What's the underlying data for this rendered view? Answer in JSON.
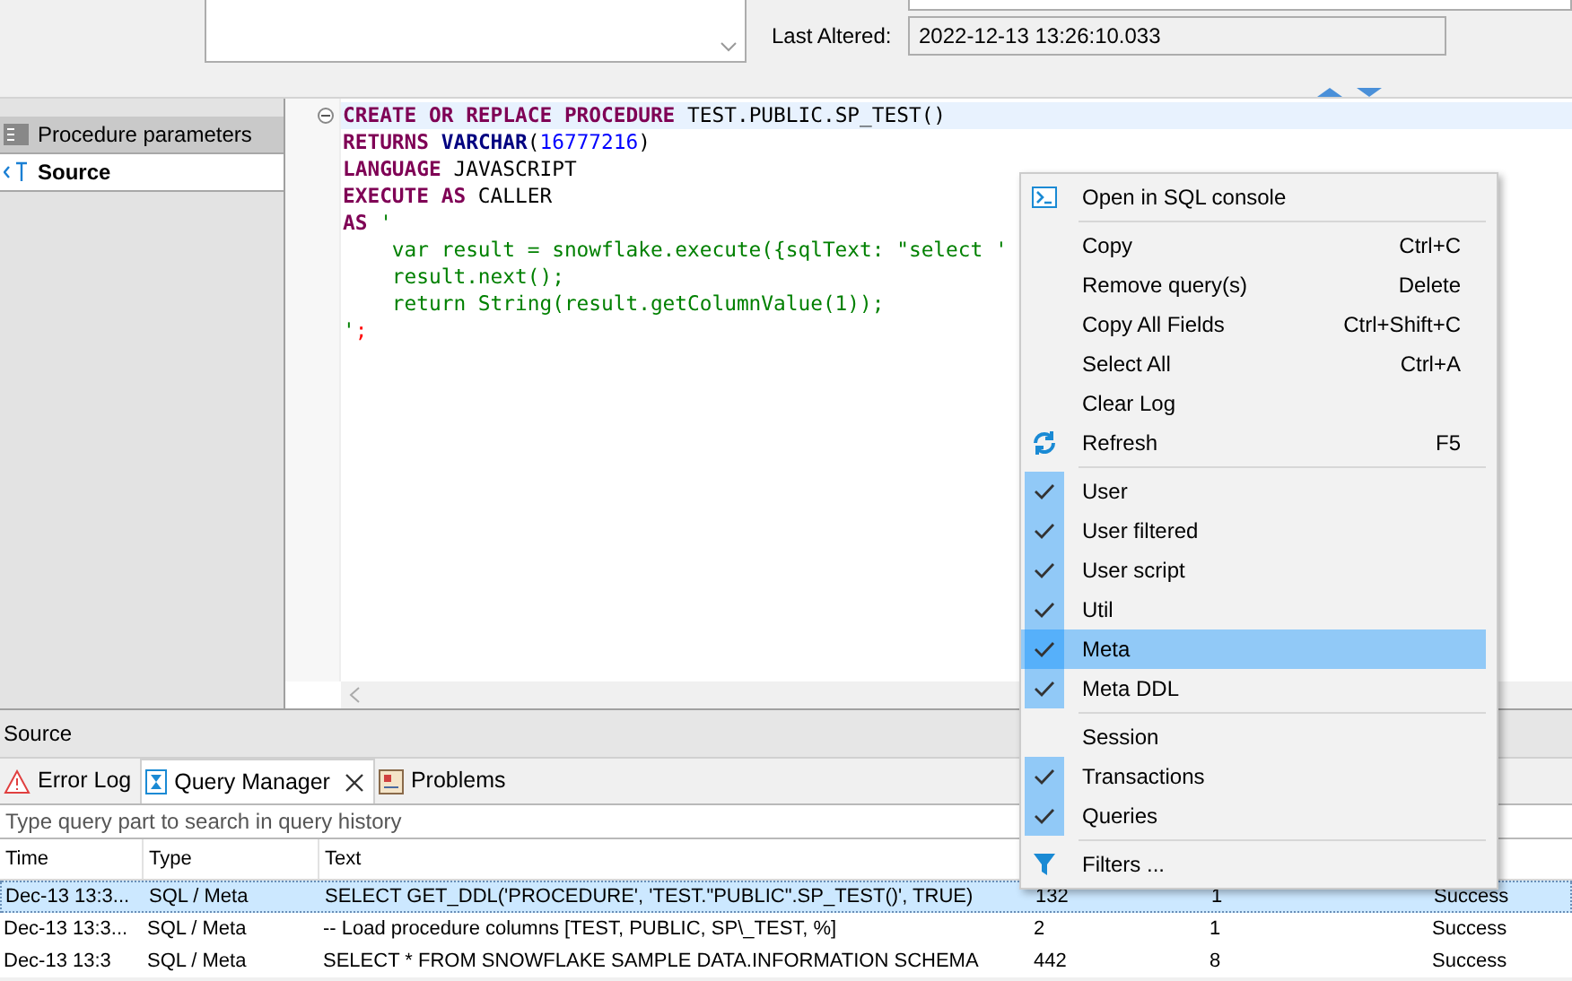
{
  "properties": {
    "last_altered_label": "Last Altered:",
    "last_altered_value": "2022-12-13 13:26:10.033"
  },
  "side_tabs": [
    {
      "label": "Procedure parameters",
      "selected": false
    },
    {
      "label": "Source",
      "selected": true
    }
  ],
  "code_lines": [
    [
      {
        "kind": "keyword",
        "text": "CREATE OR REPLACE PROCEDURE"
      },
      {
        "kind": "plain",
        "text": " TEST.PUBLIC.SP_TEST()"
      }
    ],
    [
      {
        "kind": "keyword",
        "text": "RETURNS"
      },
      {
        "kind": "type",
        "text": " VARCHAR"
      },
      {
        "kind": "plain",
        "text": "("
      },
      {
        "kind": "number",
        "text": "16777216"
      },
      {
        "kind": "plain",
        "text": ")"
      }
    ],
    [
      {
        "kind": "keyword",
        "text": "LANGUAGE"
      },
      {
        "kind": "plain",
        "text": " JAVASCRIPT"
      }
    ],
    [
      {
        "kind": "keyword",
        "text": "EXECUTE AS"
      },
      {
        "kind": "plain",
        "text": " CALLER"
      }
    ],
    [
      {
        "kind": "keyword",
        "text": "AS"
      },
      {
        "kind": "string",
        "text": " '"
      }
    ],
    [
      {
        "kind": "string",
        "text": "    var result = snowflake.execute({sqlText: \"select '"
      }
    ],
    [
      {
        "kind": "string",
        "text": "    result.next();"
      }
    ],
    [
      {
        "kind": "string",
        "text": "    return String(result.getColumnValue(1));"
      }
    ],
    [
      {
        "kind": "string",
        "text": "'"
      },
      {
        "kind": "punct",
        "text": ";"
      }
    ]
  ],
  "editor_title": "Source",
  "bottom_tabs": [
    {
      "label": "Error Log",
      "selected": false,
      "closable": false
    },
    {
      "label": "Query Manager",
      "selected": true,
      "closable": true
    },
    {
      "label": "Problems",
      "selected": false,
      "closable": false
    }
  ],
  "search": {
    "placeholder": "Type query part to search in query history"
  },
  "table": {
    "columns": [
      "Time",
      "Type",
      "Text"
    ],
    "rows": [
      {
        "selected": true,
        "cells": [
          "Dec-13 13:3...",
          "SQL / Meta",
          "SELECT GET_DDL('PROCEDURE', 'TEST.\"PUBLIC\".SP_TEST()', TRUE)",
          "132",
          "1",
          "Success"
        ]
      },
      {
        "selected": false,
        "cells": [
          "Dec-13 13:3...",
          "SQL / Meta",
          "-- Load procedure columns [TEST, PUBLIC, SP\\_TEST, %]",
          "2",
          "1",
          "Success"
        ]
      },
      {
        "selected": false,
        "cells": [
          "Dec-13 13:3",
          "SQL / Meta",
          "SELECT * FROM SNOWFLAKE SAMPLE DATA.INFORMATION SCHEMA",
          "442",
          "8",
          "Success"
        ]
      }
    ]
  },
  "context_menu": [
    {
      "kind": "command",
      "label": "Open in SQL console"
    },
    {
      "kind": "separator"
    },
    {
      "kind": "command",
      "label": "Copy",
      "shortcut": "Ctrl+C"
    },
    {
      "kind": "command",
      "label": "Remove query(s)",
      "shortcut": "Delete"
    },
    {
      "kind": "command",
      "label": "Copy All Fields",
      "shortcut": "Ctrl+Shift+C"
    },
    {
      "kind": "command",
      "label": "Select All",
      "shortcut": "Ctrl+A"
    },
    {
      "kind": "command",
      "label": "Clear Log"
    },
    {
      "kind": "command",
      "label": "Refresh",
      "shortcut": "F5"
    },
    {
      "kind": "separator"
    },
    {
      "kind": "check",
      "label": "User",
      "checked": true,
      "selected": false
    },
    {
      "kind": "check",
      "label": "User filtered",
      "checked": true,
      "selected": false
    },
    {
      "kind": "check",
      "label": "User script",
      "checked": true,
      "selected": false
    },
    {
      "kind": "check",
      "label": "Util",
      "checked": true,
      "selected": false
    },
    {
      "kind": "check",
      "label": "Meta",
      "checked": true,
      "selected": true
    },
    {
      "kind": "check",
      "label": "Meta DDL",
      "checked": true,
      "selected": false
    },
    {
      "kind": "separator"
    },
    {
      "kind": "check",
      "label": "Session",
      "checked": false,
      "selected": false
    },
    {
      "kind": "check",
      "label": "Transactions",
      "checked": true,
      "selected": false
    },
    {
      "kind": "check",
      "label": "Queries",
      "checked": true,
      "selected": false
    },
    {
      "kind": "separator"
    },
    {
      "kind": "command",
      "label": "Filters ..."
    }
  ]
}
